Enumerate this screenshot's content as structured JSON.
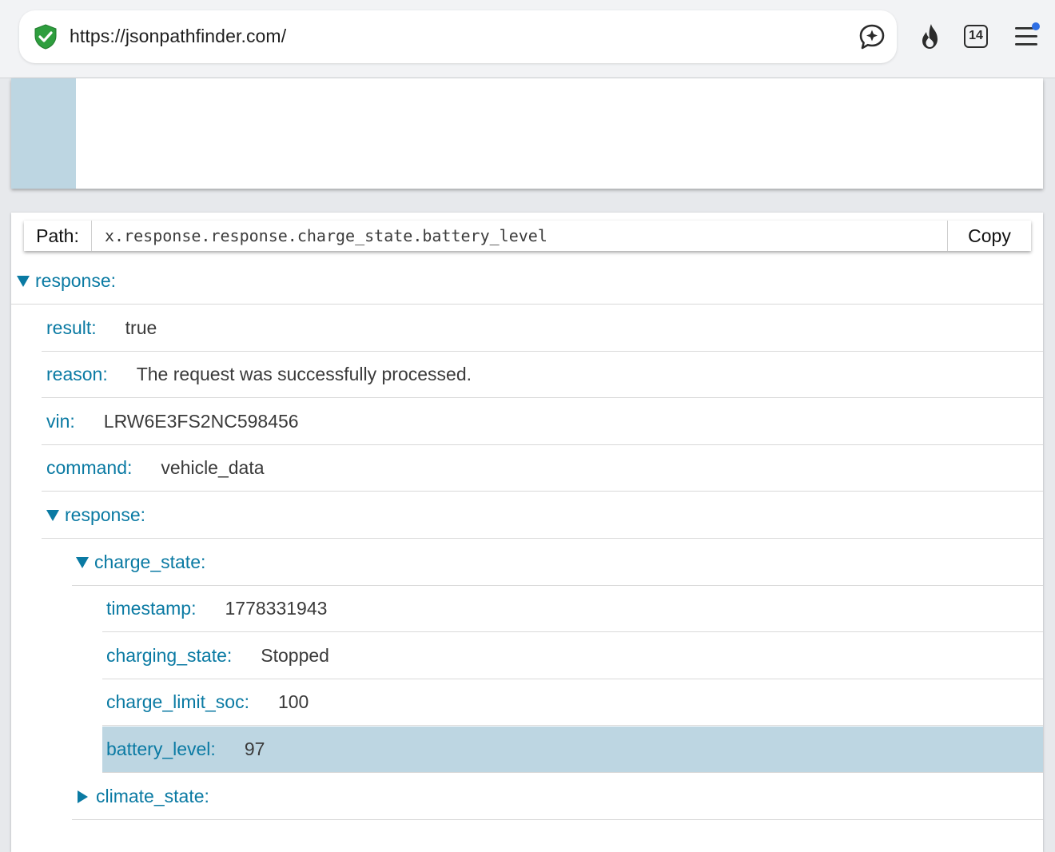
{
  "browser": {
    "url": "https://jsonpathfinder.com/",
    "tab_count": "14",
    "icons": [
      "shield-check-icon",
      "ai-assistant-icon",
      "fire-icon",
      "tabs-icon",
      "menu-icon"
    ]
  },
  "path_bar": {
    "label": "Path:",
    "value": "x.response.response.charge_state.battery_level",
    "copy_label": "Copy"
  },
  "tree": {
    "root": {
      "key": "response:"
    },
    "result": {
      "key": "result:",
      "value": "true"
    },
    "reason": {
      "key": "reason:",
      "value": "The request was successfully processed."
    },
    "vin": {
      "key": "vin:",
      "value": "LRW6E3FS2NC598456"
    },
    "command": {
      "key": "command:",
      "value": "vehicle_data"
    },
    "inner_response": {
      "key": "response:"
    },
    "charge_state": {
      "key": "charge_state:"
    },
    "timestamp": {
      "key": "timestamp:",
      "value": "1778331943"
    },
    "charging_state": {
      "key": "charging_state:",
      "value": "Stopped"
    },
    "charge_limit_soc": {
      "key": "charge_limit_soc:",
      "value": "100"
    },
    "battery_level": {
      "key": "battery_level:",
      "value": "97"
    },
    "climate_state": {
      "key": "climate_state:"
    }
  },
  "colors": {
    "key": "#0a7aa3",
    "value": "#3a3a3a",
    "selected_row": "#bdd6e2",
    "shield": "#2e9e3e",
    "notify_dot": "#2f6fe4"
  }
}
